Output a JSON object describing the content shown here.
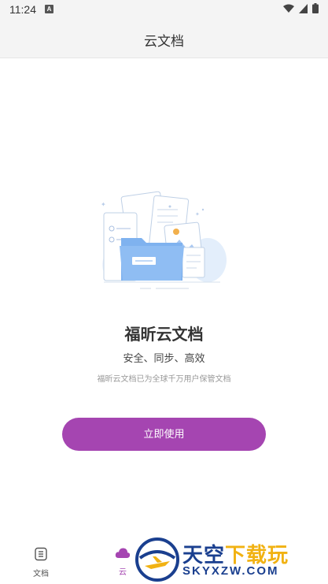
{
  "status_bar": {
    "time": "11:24",
    "notification_badge": "A"
  },
  "app_bar": {
    "title": "云文档"
  },
  "main": {
    "headline": "福昕云文档",
    "tagline": "安全、同步、高效",
    "subtext": "福昕云文档已为全球千万用户保管文档",
    "cta_label": "立即使用"
  },
  "bottom_nav": {
    "items": [
      {
        "label": "文档",
        "icon": "document-icon",
        "active": false
      },
      {
        "label": "云",
        "icon": "cloud-icon",
        "active": true
      }
    ]
  },
  "watermark": {
    "title_main": "天空",
    "title_highlight": "下载玩",
    "subtitle": "SKYXZW.COM"
  },
  "colors": {
    "accent": "#a545b1",
    "app_bar_bg": "#f4f4f4",
    "illustration_blue": "#7fb2ef",
    "watermark_blue": "#1a3f8f",
    "watermark_yellow": "#f1b213"
  }
}
